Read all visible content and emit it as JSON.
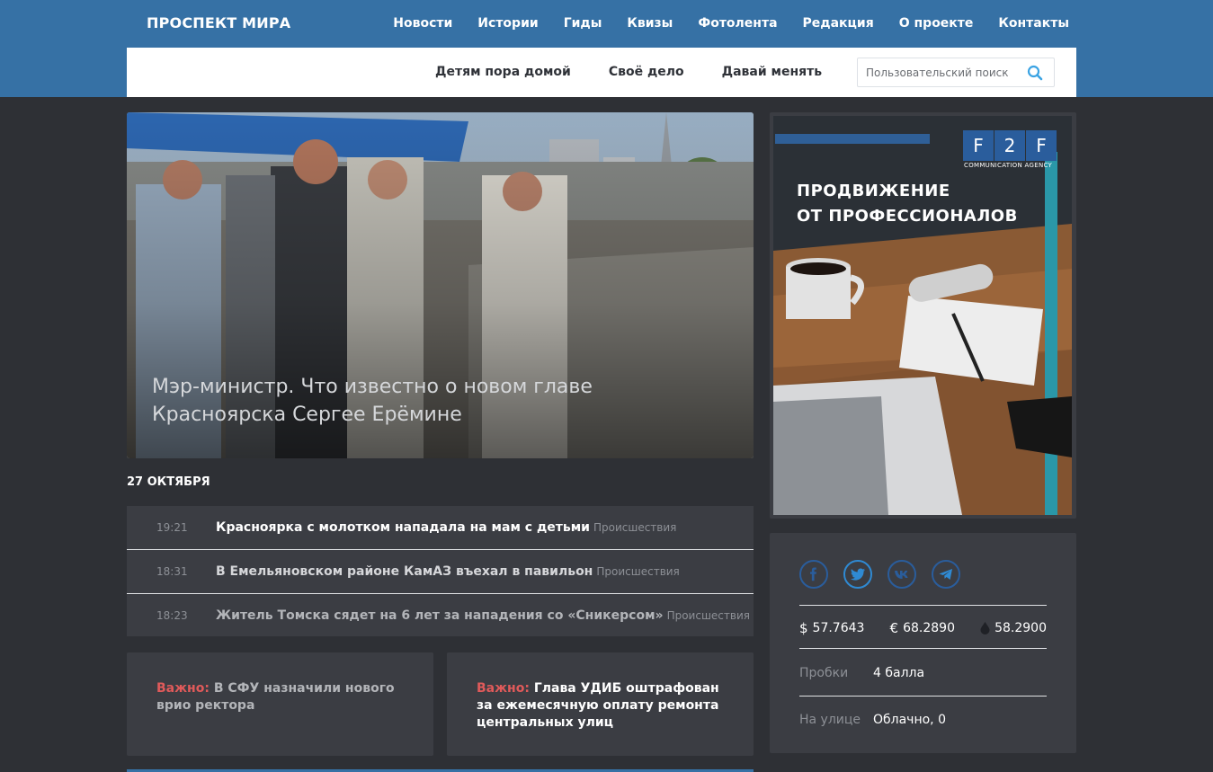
{
  "header": {
    "logo": "ПРОСПЕКТ МИРА",
    "nav": [
      "Новости",
      "Истории",
      "Гиды",
      "Квизы",
      "Фотолента",
      "Редакция",
      "О проекте",
      "Контакты"
    ],
    "subnav": [
      "Детям пора домой",
      "Своё дело",
      "Давай менять"
    ],
    "search_placeholder": "Пользовательский поиск"
  },
  "hero": {
    "title": "Мэр-министр. Что известно о новом главе Красноярска Сергее Ерёмине"
  },
  "feed": {
    "date": "27 ОКТЯБРЯ",
    "items": [
      {
        "time": "19:21",
        "title": "Красноярка с молотком нападала на мам с детьми",
        "category": "Происшествия"
      },
      {
        "time": "18:31",
        "title": "В Емельяновском районе КамАЗ въехал в павильон",
        "category": "Происшествия"
      },
      {
        "time": "18:23",
        "title": "Житель Томска сядет на 6 лет за нападения со «Сникерсом»",
        "category": "Происшествия"
      }
    ]
  },
  "important": [
    {
      "label": "Важно:",
      "text": "В СФУ назначили нового врио ректора"
    },
    {
      "label": "Важно:",
      "text": "Глава УДИБ оштрафован за ежемесячную оплату ремонта центральных улиц"
    }
  ],
  "ad": {
    "brand": [
      "F",
      "2",
      "F"
    ],
    "brand_sub": "COMMUNICATION AGENCY",
    "line1": "ПРОДВИЖЕНИЕ",
    "line2": "ОТ ПРОФЕССИОНАЛОВ"
  },
  "widget": {
    "social_icons": [
      "facebook-icon",
      "twitter-icon",
      "vk-icon",
      "telegram-icon"
    ],
    "rates": [
      {
        "symbol": "$",
        "value": "57.7643"
      },
      {
        "symbol": "€",
        "value": "68.2890"
      },
      {
        "symbol": "oil-drop-icon",
        "value": "58.2900"
      }
    ],
    "traffic_label": "Пробки",
    "traffic_value": "4 балла",
    "weather_label": "На улице",
    "weather_value": "Облачно, 0"
  },
  "colors": {
    "header_blue": "#3671a5",
    "background": "#2e3035",
    "card": "#3b3d43",
    "accent_red": "#e05a5a",
    "social_blue": "#2a5d9c"
  }
}
